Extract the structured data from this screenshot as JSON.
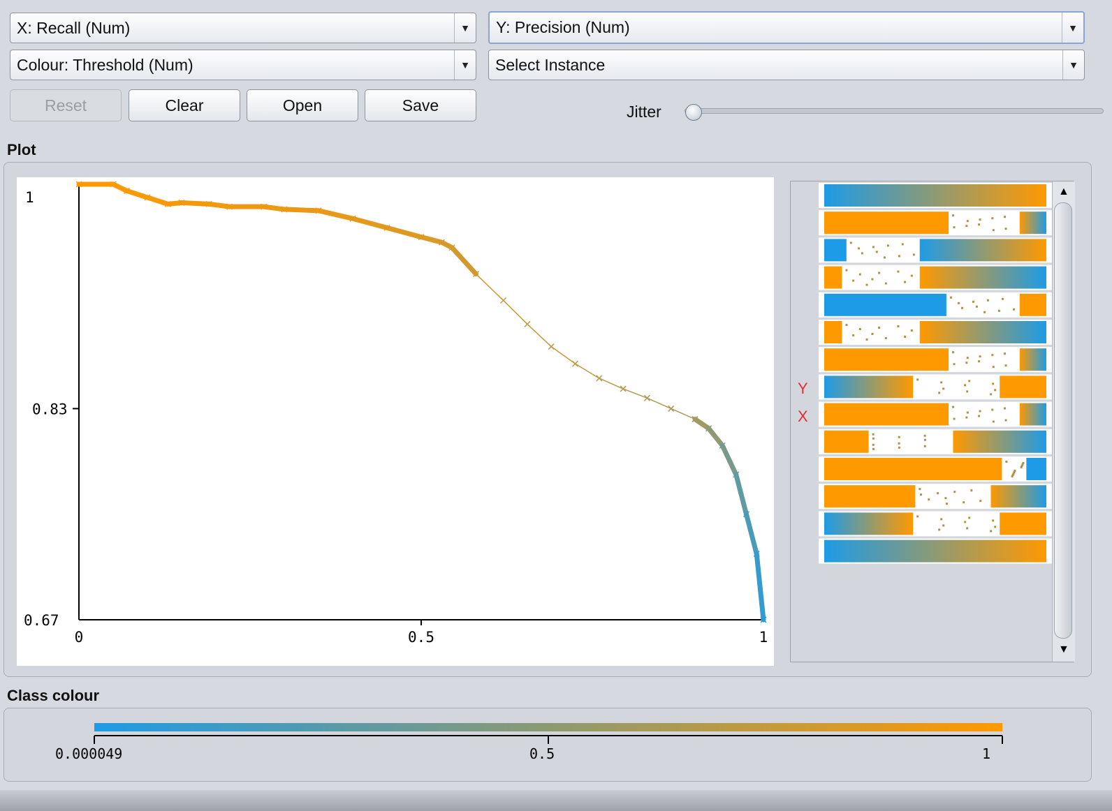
{
  "controls": {
    "x_axis": "X: Recall (Num)",
    "y_axis": "Y: Precision (Num)",
    "colour": "Colour: Threshold (Num)",
    "instance": "Select Instance",
    "reset": "Reset",
    "clear": "Clear",
    "open": "Open",
    "save": "Save",
    "jitter_label": "Jitter",
    "jitter_value": 0
  },
  "sections": {
    "plot": "Plot",
    "class_colour": "Class colour"
  },
  "attr_panel": {
    "y_marker": "Y",
    "x_marker": "X",
    "marker_color": "#e03030"
  },
  "colour_bar": {
    "min_label": "0.000049",
    "mid_label": "0.5",
    "max_label": "1",
    "low_color": "#1e9be6",
    "high_color": "#ff9900"
  },
  "chart_data": {
    "type": "line",
    "xlim": [
      0,
      1
    ],
    "ylim": [
      0.67,
      1
    ],
    "x_ticks": [
      "0",
      "0.5",
      "1"
    ],
    "y_ticks": [
      "1",
      "0.83",
      "0.67"
    ],
    "colour_by": "threshold",
    "points": [
      {
        "x": 0.0,
        "y": 1.0,
        "t": 1.0
      },
      {
        "x": 0.05,
        "y": 1.0,
        "t": 0.99
      },
      {
        "x": 0.07,
        "y": 0.995,
        "t": 0.98
      },
      {
        "x": 0.1,
        "y": 0.99,
        "t": 0.97
      },
      {
        "x": 0.13,
        "y": 0.985,
        "t": 0.96
      },
      {
        "x": 0.15,
        "y": 0.986,
        "t": 0.95
      },
      {
        "x": 0.19,
        "y": 0.985,
        "t": 0.94
      },
      {
        "x": 0.22,
        "y": 0.983,
        "t": 0.93
      },
      {
        "x": 0.27,
        "y": 0.983,
        "t": 0.92
      },
      {
        "x": 0.3,
        "y": 0.981,
        "t": 0.91
      },
      {
        "x": 0.35,
        "y": 0.98,
        "t": 0.9
      },
      {
        "x": 0.4,
        "y": 0.974,
        "t": 0.88
      },
      {
        "x": 0.45,
        "y": 0.967,
        "t": 0.86
      },
      {
        "x": 0.5,
        "y": 0.96,
        "t": 0.84
      },
      {
        "x": 0.53,
        "y": 0.956,
        "t": 0.82
      },
      {
        "x": 0.545,
        "y": 0.952,
        "t": 0.8
      },
      {
        "x": 0.58,
        "y": 0.932,
        "t": 0.78
      },
      {
        "x": 0.62,
        "y": 0.912,
        "t": 0.76
      },
      {
        "x": 0.655,
        "y": 0.894,
        "t": 0.74
      },
      {
        "x": 0.69,
        "y": 0.877,
        "t": 0.72
      },
      {
        "x": 0.725,
        "y": 0.864,
        "t": 0.7
      },
      {
        "x": 0.76,
        "y": 0.853,
        "t": 0.68
      },
      {
        "x": 0.795,
        "y": 0.845,
        "t": 0.66
      },
      {
        "x": 0.83,
        "y": 0.838,
        "t": 0.64
      },
      {
        "x": 0.865,
        "y": 0.83,
        "t": 0.62
      },
      {
        "x": 0.9,
        "y": 0.822,
        "t": 0.58
      },
      {
        "x": 0.92,
        "y": 0.815,
        "t": 0.5
      },
      {
        "x": 0.94,
        "y": 0.802,
        "t": 0.4
      },
      {
        "x": 0.96,
        "y": 0.78,
        "t": 0.3
      },
      {
        "x": 0.975,
        "y": 0.75,
        "t": 0.2
      },
      {
        "x": 0.99,
        "y": 0.72,
        "t": 0.1
      },
      {
        "x": 1.0,
        "y": 0.67,
        "t": 0.0
      }
    ]
  }
}
